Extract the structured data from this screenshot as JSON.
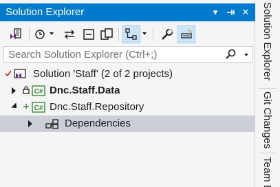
{
  "panel": {
    "title": "Solution Explorer",
    "controls": {
      "dropdown": "▾",
      "pin": "⊣",
      "close": "✕"
    }
  },
  "toolbar": {
    "buttons": [
      {
        "name": "switch-views-icon"
      },
      {
        "name": "pending-changes-filter-icon"
      },
      {
        "name": "sync-with-active-document-icon"
      },
      {
        "name": "collapse-all-icon"
      },
      {
        "name": "show-all-files-icon"
      },
      {
        "name": "view-class-diagram-icon",
        "active": true
      },
      {
        "name": "properties-icon"
      },
      {
        "name": "preview-selected-items-icon",
        "active": true
      }
    ]
  },
  "search": {
    "placeholder": "Search Solution Explorer (Ctrl+;)"
  },
  "tree": {
    "solution_label": "Solution 'Staff' (2 of 2 projects)",
    "project1_label": "Dnc.Staff.Data",
    "project2_label": "Dnc.Staff.Repository",
    "dependencies_label": "Dependencies"
  },
  "side_tabs": [
    "Solution Explorer",
    "Git Changes",
    "Team E"
  ],
  "colors": {
    "accent": "#007acc",
    "panel_bg": "#f5f5f5",
    "selection": "#ccced8",
    "csharp_green": "#388a34",
    "solution_purple": "#68217a"
  }
}
